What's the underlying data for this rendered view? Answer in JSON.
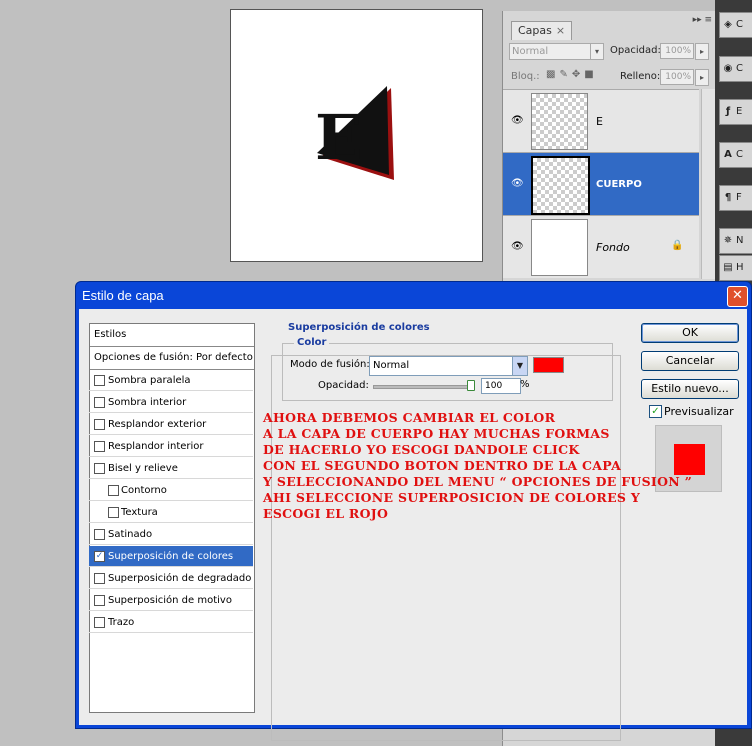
{
  "layers_panel": {
    "tab": "Capas",
    "tab_close": "×",
    "menu": "▸▸ ≡",
    "blend_mode": "Normal",
    "opacity_label": "Opacidad:",
    "opacity_value": "100%",
    "lock_label": "Bloq.:",
    "fill_label": "Relleno:",
    "fill_value": "100%",
    "layers": [
      {
        "name": "E",
        "visible": true
      },
      {
        "name": "CUERPO",
        "visible": true,
        "selected": true
      },
      {
        "name": "Fondo",
        "visible": true,
        "locked": true
      }
    ]
  },
  "right_strip": {
    "items": [
      "C",
      "C",
      "E",
      "C",
      "F",
      "N",
      "H"
    ]
  },
  "canvas": {
    "glyph": "E"
  },
  "dialog": {
    "title": "Estilo de capa",
    "close": "✕",
    "styles_header": "Estilos",
    "blend_options": "Opciones de fusión: Por defecto",
    "style_items": [
      {
        "label": "Sombra paralela",
        "checked": false
      },
      {
        "label": "Sombra interior",
        "checked": false
      },
      {
        "label": "Resplandor exterior",
        "checked": false
      },
      {
        "label": "Resplandor interior",
        "checked": false
      },
      {
        "label": "Bisel y relieve",
        "checked": false
      },
      {
        "label": "Contorno",
        "checked": false,
        "indent": true
      },
      {
        "label": "Textura",
        "checked": false,
        "indent": true
      },
      {
        "label": "Satinado",
        "checked": false
      },
      {
        "label": "Superposición de colores",
        "checked": true,
        "selected": true
      },
      {
        "label": "Superposición de degradado",
        "checked": false
      },
      {
        "label": "Superposición de motivo",
        "checked": false
      },
      {
        "label": "Trazo",
        "checked": false
      }
    ],
    "section_title": "Superposición de colores",
    "color_group": "Color",
    "blend_mode_label": "Modo de fusión:",
    "blend_mode_value": "Normal",
    "overlay_color": "#ff0000",
    "opacity_label": "Opacidad:",
    "opacity_value": "100",
    "opacity_unit": "%",
    "buttons": {
      "ok": "OK",
      "cancel": "Cancelar",
      "new_style": "Estilo nuevo...",
      "preview_label": "Previsualizar",
      "preview_checked": true
    }
  },
  "annotation": {
    "lines": [
      "AHORA DEBEMOS CAMBIAR EL COLOR",
      "A LA CAPA DE CUERPO HAY MUCHAS FORMAS",
      "DE HACERLO YO ESCOGI DANDOLE CLICK",
      "CON EL SEGUNDO BOTON DENTRO DE LA CAPA",
      "Y SELECCIONANDO DEL MENU “ OPCIONES DE FUSION ”",
      "AHI SELECCIONE SUPERPOSICION DE COLORES Y",
      "ESCOGI EL ROJO"
    ]
  }
}
